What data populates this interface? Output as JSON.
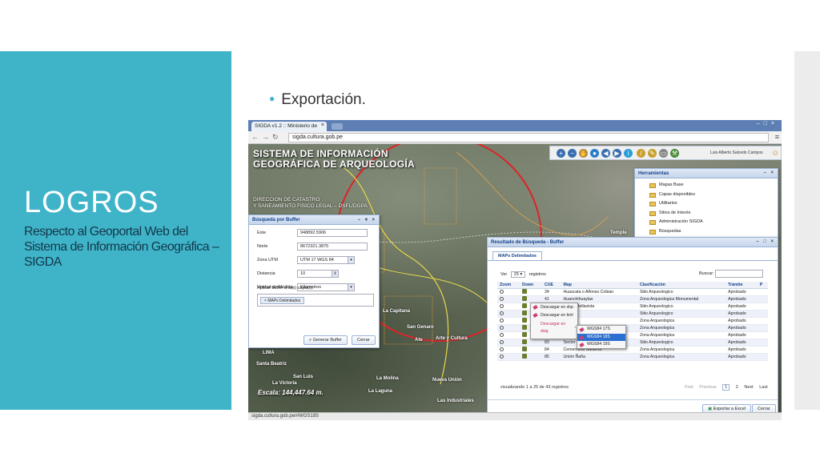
{
  "slide": {
    "title": "LOGROS",
    "subtitle": "Respecto al Geoportal Web del Sistema de Información Geográfica – SIGDA",
    "bullet": "Exportación."
  },
  "colors": {
    "accent": "#3fb4c9",
    "subtitle_text": "#13384a"
  },
  "browser": {
    "tab_title": "SIGDA v1.2 :: Ministerio de",
    "url": "sigda.cultura.gob.pe",
    "status_url": "sigda.cultura.gob.pe/#WGS18S"
  },
  "map": {
    "banner_title_1": "SISTEMA DE INFORMACIÓN",
    "banner_title_2": "GEOGRÁFICA DE ARQUEOLOGÍA",
    "banner_sub_1": "DIRECCION DE CATASTRO",
    "banner_sub_2": "Y SANEAMIENTO FISICO LEGAL – DSFL/DGPA",
    "scale": "Escala: 144,447.64 m.",
    "labels": {
      "lima": "LIMA",
      "santa_beatriz": "Santa Beatriz",
      "san_luis": "San Luis",
      "la_victoria": "La Victoria",
      "la_molina": "La Molina",
      "la_capitana": "La Capitana",
      "san_genaro": "San Genaro",
      "ate": "Ate",
      "arte_cultura": "Arte y Cultura",
      "temple": "Temple",
      "la_laguna": "La Laguna",
      "las_industriales": "Las Industriales",
      "nueva_union": "Nueva Unión"
    }
  },
  "toolbar": {
    "user_name": "Luis Alberto Salcedo Campos"
  },
  "herramientas": {
    "title": "Herramientas",
    "items": [
      "Mapas Base",
      "Capas disponibles",
      "Utilitarios",
      "Sitios de Interés",
      "Administración SIGDA",
      "Búsquedas"
    ]
  },
  "buffer": {
    "title": "Búsqueda por Buffer",
    "este_label": "Este",
    "este_value": "948892.5906",
    "norte_label": "Norte",
    "norte_value": "8672321.3875",
    "zona_label": "Zona UTM",
    "zona_value": "UTM 17 WGS 84",
    "distancia_label": "Distancia",
    "distancia_value": "10",
    "unidad_label": "Unidad de Medida",
    "unidad_value": "Kilometros",
    "capas_label": "Aplicar buffer a la(s) capa(s):",
    "capa_tag": "MAPs Delimitados",
    "generar_button": "Generar Buffer",
    "cerrar_button": "Cerrar"
  },
  "result": {
    "title": "Resultado de Búsqueda - Buffer",
    "tab": "MAPs Delimitados",
    "ver_label": "Ver",
    "ver_value": "25",
    "registros_label": "registros",
    "buscar_label": "Buscar:",
    "columns": [
      "Zoom",
      "Down",
      "CUE",
      "Map",
      "Clasificación",
      "Trámite",
      "P"
    ],
    "rows": [
      {
        "cue": "34",
        "map": "Huascata o Alfonso Cobian",
        "clas": "Sitio Arqueologico",
        "tram": "Aprobado"
      },
      {
        "cue": "41",
        "map": "Huanchihuaylas",
        "clas": "Zona Arqueologica Monumental",
        "tram": "Aprobado"
      },
      {
        "cue": "42",
        "map": "Huaca Bellavista",
        "clas": "Sitio Arqueologico",
        "tram": "Aprobado"
      },
      {
        "cue": "46",
        "map": "Portillo",
        "clas": "Sitio Arqueologico",
        "tram": "Aprobado"
      },
      {
        "cue": "",
        "map": "",
        "clas": "Zona Arqueologica",
        "tram": "Aprobado"
      },
      {
        "cue": "",
        "map": "",
        "clas": "Zona Arqueologica",
        "tram": "Aprobado"
      },
      {
        "cue": "",
        "map": "",
        "clas": "Zona Arqueologica",
        "tram": "Aprobado"
      },
      {
        "cue": "83",
        "map": "Sector VI-B",
        "clas": "Sitio Arqueologico",
        "tram": "Aprobado"
      },
      {
        "cue": "84",
        "map": "Cementerio Nievería",
        "clas": "Zona Arqueologica",
        "tram": "Aprobado"
      },
      {
        "cue": "85",
        "map": "Unión Ñaña",
        "clas": "Zona Arqueologica",
        "tram": "Aprobado"
      }
    ],
    "info": "visualizando 1 a 25 de 43 registros",
    "pager": {
      "first": "First",
      "previous": "Previous",
      "page1": "1",
      "page2": "2",
      "next": "Next",
      "last": "Last"
    },
    "exportar_button": "Exportar a Excel",
    "cerrar_button": "Cerrar"
  },
  "context_menu": {
    "items": [
      "Descargar en shp",
      "Descargar en kml",
      "Descargar en dwg"
    ],
    "submenu": [
      "WGS84 17S",
      "WGS84 18S",
      "WGS84 19S"
    ]
  }
}
